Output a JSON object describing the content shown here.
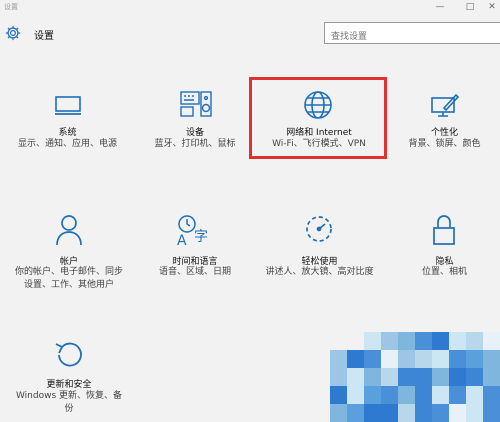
{
  "window": {
    "title": "设置",
    "minimize_glyph": "—",
    "maximize_glyph": "□",
    "close_glyph": "✕"
  },
  "header": {
    "title": "设置",
    "gear_icon": "gear-icon"
  },
  "search": {
    "placeholder": "查找设置"
  },
  "accent_color": "#1e6fb8",
  "highlight_color": "#e03131",
  "categories": [
    {
      "id": "system",
      "name": "系统",
      "desc": "显示、通知、应用、电源",
      "icon": "monitor-icon"
    },
    {
      "id": "devices",
      "name": "设备",
      "desc": "蓝牙、打印机、鼠标",
      "icon": "keyboard-speaker-icon"
    },
    {
      "id": "network",
      "name": "网络和 Internet",
      "desc": "Wi-Fi、飞行模式、VPN",
      "icon": "globe-icon"
    },
    {
      "id": "personalization",
      "name": "个性化",
      "desc": "背景、锁屏、颜色",
      "icon": "paint-brush-icon"
    },
    {
      "id": "accounts",
      "name": "帐户",
      "desc": "你的帐户、电子邮件、同步设置、工作、其他用户",
      "icon": "person-icon"
    },
    {
      "id": "time-language",
      "name": "时间和语言",
      "desc": "语音、区域、日期",
      "icon": "time-language-icon"
    },
    {
      "id": "ease-of-access",
      "name": "轻松使用",
      "desc": "讲述人、放大镜、高对比度",
      "icon": "dashed-timer-icon"
    },
    {
      "id": "privacy",
      "name": "隐私",
      "desc": "位置、相机",
      "icon": "lock-icon"
    },
    {
      "id": "update-security",
      "name": "更新和安全",
      "desc": "Windows 更新、恢复、备份",
      "icon": "refresh-arrow-icon"
    }
  ]
}
